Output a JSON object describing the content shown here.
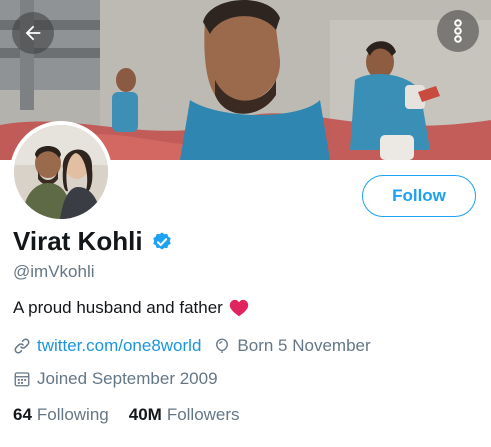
{
  "profile": {
    "name": "Virat Kohli",
    "handle": "@imVkohli",
    "bio": "A proud husband and father",
    "website": "twitter.com/one8world",
    "birthday": "Born 5 November",
    "joined": "Joined September 2009",
    "following_count": "64",
    "following_label": "Following",
    "followers_count": "40M",
    "followers_label": "Followers",
    "verified": true
  },
  "actions": {
    "follow_label": "Follow"
  },
  "icons": {
    "back": "arrow-left-icon",
    "more": "more-vertical-icon",
    "verified": "verified-badge-icon",
    "heart": "red-heart-emoji",
    "link": "link-icon",
    "birthday": "balloon-icon",
    "joined": "calendar-icon"
  },
  "colors": {
    "accent": "#1da1f2",
    "link": "#1b95e0",
    "secondary_text": "#657786",
    "primary_text": "#14171a",
    "heart": "#e0245e"
  }
}
